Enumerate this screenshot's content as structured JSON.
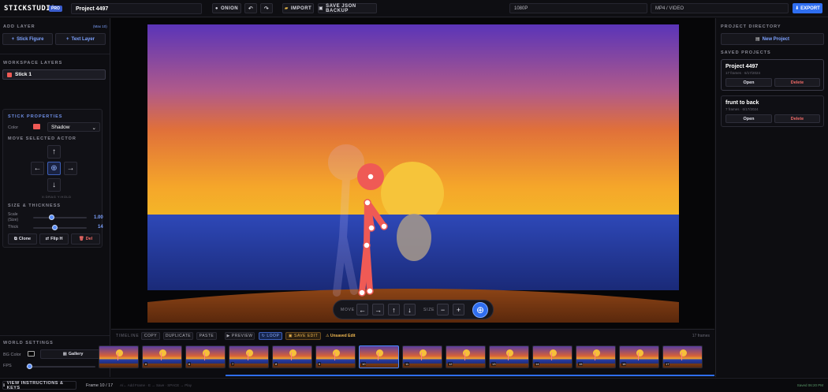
{
  "header": {
    "logo": "STICKSTUDIO",
    "badge": "PRO",
    "project_name": "Project 4497",
    "onion_label": "ONION",
    "undo_icon": "undo-icon",
    "redo_icon": "redo-icon",
    "import_label": "IMPORT",
    "save_label": "SAVE JSON BACKUP",
    "resolution": "1080P",
    "format": "MP4 / VIDEO",
    "export_label": "EXPORT"
  },
  "left": {
    "add_layer_title": "ADD LAYER",
    "add_layer_hint": "(Max 10)",
    "stick_figure_btn": "Stick Figure",
    "text_layer_btn": "Text Layer",
    "workspace_title": "WORKSPACE LAYERS",
    "layers": [
      {
        "name": "Stick 1",
        "color": "#ef5a55"
      }
    ],
    "props_title": "STICK PROPERTIES",
    "color_label": "Color",
    "color_value": "#ef5a55",
    "shadow_option": "Shadow",
    "move_title": "MOVE SELECTED ACTOR",
    "move_hint": "X:DRAG Y:HOLD",
    "size_title": "SIZE & THICKNESS",
    "scale_label": "Scale\n(Size)",
    "scale_value": "1.00",
    "scale_fraction": 0.35,
    "thick_label": "Thick",
    "thick_value": "14",
    "thick_fraction": 0.4,
    "clone_btn": "Clone",
    "flip_btn": "Flip H",
    "del_btn": "Del",
    "world_title": "WORLD SETTINGS",
    "bg_color_label": "BG Color",
    "gallery_btn": "Gallery",
    "fps_label": "FPS",
    "fps_value": "12",
    "fps_fraction": 0.05
  },
  "canvas": {
    "toolbar": {
      "move_label": "MOVE",
      "size_label": "SIZE"
    }
  },
  "right": {
    "directory_title": "PROJECT DIRECTORY",
    "new_project_btn": "New Project",
    "saved_title": "SAVED PROJECTS",
    "projects": [
      {
        "name": "Project 4497",
        "meta": "17 frames · 6/17/2024",
        "open": "Open",
        "delete": "Delete"
      },
      {
        "name": "frunt to back",
        "meta": "7 frames · 6/17/2024",
        "open": "Open",
        "delete": "Delete"
      }
    ]
  },
  "timeline": {
    "label": "TIMELINE",
    "copy_btn": "COPY",
    "duplicate_btn": "DUPLICATE",
    "paste_btn": "PASTE",
    "preview_btn": "PREVIEW",
    "loop_btn": "LOOP",
    "save_edit_btn": "SAVE EDIT",
    "unsaved_label": "Unsaved Edit",
    "frame_count": "17 frames",
    "frames": [
      "",
      "6",
      "6",
      "7",
      "8",
      "9",
      "10",
      "11",
      "12",
      "13",
      "14",
      "15",
      "16",
      "17"
    ],
    "active_frame": "10"
  },
  "bottom": {
    "instructions_btn": "VIEW INSTRUCTIONS & KEYS",
    "frame_indicator": "Frame 10 / 17",
    "shortcuts": "A/← Add Frame · E → Save · SPACE → Play",
    "saved_status": "Saved 06:20 PM"
  }
}
